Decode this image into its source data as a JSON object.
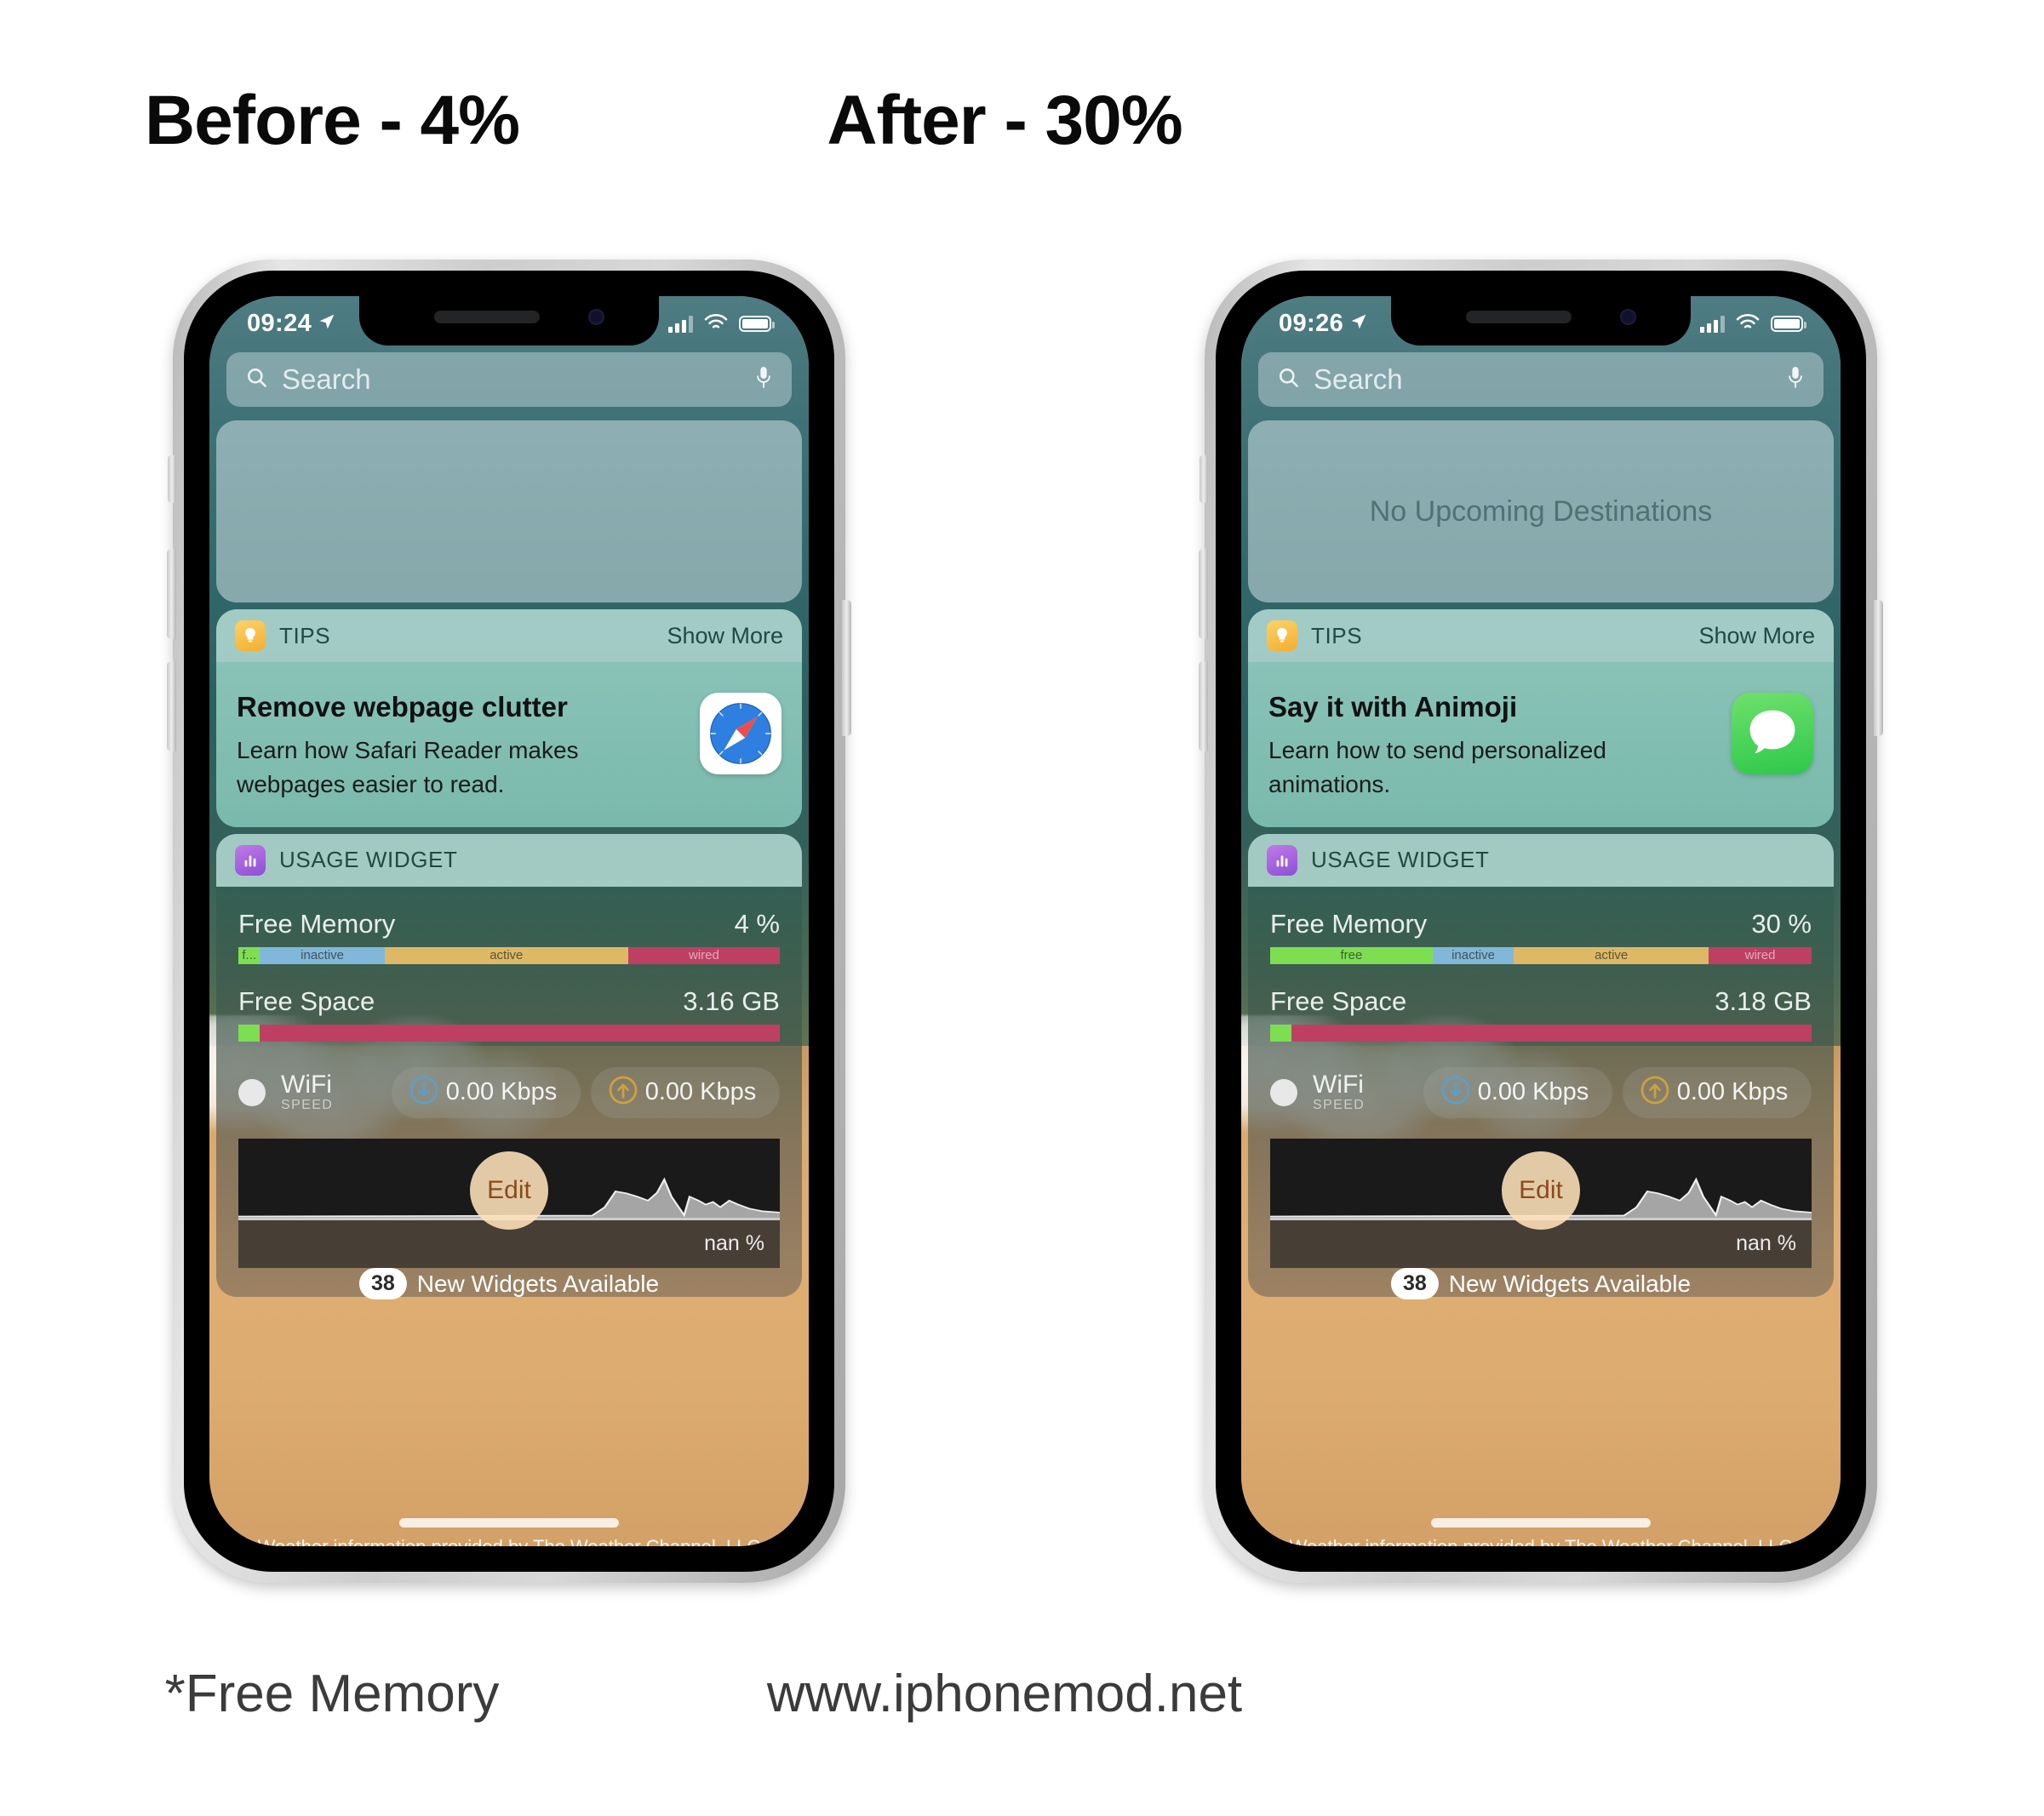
{
  "headings": {
    "left": "Before - 4%",
    "right": "After - 30%"
  },
  "captions": {
    "left": "*Free Memory",
    "right": "www.iphonemod.net"
  },
  "phones": [
    {
      "id": "before",
      "status_bar": {
        "time": "09:24",
        "location_icon": "location-arrow-icon",
        "cellular_icon": "signal-bars-icon",
        "wifi_icon": "wifi-icon",
        "battery_icon": "battery-icon"
      },
      "search": {
        "placeholder": "Search",
        "search_icon": "search-icon",
        "mic_icon": "microphone-icon"
      },
      "maps_widget": {
        "text": ""
      },
      "tips_widget": {
        "header": "TIPS",
        "action": "Show More",
        "icon": "tips-lightbulb-icon",
        "title": "Remove webpage clutter",
        "subtitle": "Learn how Safari Reader makes webpages easier to read.",
        "app_icon": "safari-compass-icon"
      },
      "usage_widget": {
        "header": "USAGE WIDGET",
        "icon": "usage-barchart-icon",
        "memory_label": "Free Memory",
        "memory_value": "4 %",
        "memory_segments": [
          {
            "label": "f...",
            "percent": 4,
            "key": "free"
          },
          {
            "label": "inactive",
            "percent": 23,
            "key": "inactive"
          },
          {
            "label": "active",
            "percent": 45,
            "key": "active"
          },
          {
            "label": "wired",
            "percent": 28,
            "key": "wired"
          }
        ],
        "space_label": "Free Space",
        "space_value": "3.16 GB",
        "space_free_percent": 4,
        "network_name": "WiFi",
        "network_sub": "SPEED",
        "download_icon": "download-arrow-icon",
        "download_value": "0.00 Kbps",
        "upload_icon": "upload-arrow-icon",
        "upload_value": "0.00 Kbps",
        "graph_footer": "nan %"
      },
      "edit_label": "Edit",
      "new_widgets_count": "38",
      "new_widgets_label": "New Widgets Available",
      "weather_credit": "Weather information provided by The Weather Channel, LLC"
    },
    {
      "id": "after",
      "status_bar": {
        "time": "09:26",
        "location_icon": "location-arrow-icon",
        "cellular_icon": "signal-bars-icon",
        "wifi_icon": "wifi-icon",
        "battery_icon": "battery-icon"
      },
      "search": {
        "placeholder": "Search",
        "search_icon": "search-icon",
        "mic_icon": "microphone-icon"
      },
      "maps_widget": {
        "text": "No Upcoming Destinations"
      },
      "tips_widget": {
        "header": "TIPS",
        "action": "Show More",
        "icon": "tips-lightbulb-icon",
        "title": "Say it with Animoji",
        "subtitle": "Learn how to send personalized animations.",
        "app_icon": "messages-bubble-icon"
      },
      "usage_widget": {
        "header": "USAGE WIDGET",
        "icon": "usage-barchart-icon",
        "memory_label": "Free Memory",
        "memory_value": "30 %",
        "memory_segments": [
          {
            "label": "free",
            "percent": 30,
            "key": "free"
          },
          {
            "label": "inactive",
            "percent": 15,
            "key": "inactive"
          },
          {
            "label": "active",
            "percent": 36,
            "key": "active"
          },
          {
            "label": "wired",
            "percent": 19,
            "key": "wired"
          }
        ],
        "space_label": "Free Space",
        "space_value": "3.18 GB",
        "space_free_percent": 4,
        "network_name": "WiFi",
        "network_sub": "SPEED",
        "download_icon": "download-arrow-icon",
        "download_value": "0.00 Kbps",
        "upload_icon": "upload-arrow-icon",
        "upload_value": "0.00 Kbps",
        "graph_footer": "nan %"
      },
      "edit_label": "Edit",
      "new_widgets_count": "38",
      "new_widgets_label": "New Widgets Available",
      "weather_credit": "Weather information provided by The Weather Channel, LLC"
    }
  ],
  "colors": {
    "free": "#7ede52",
    "inactive": "#81b8da",
    "active": "#ddb965",
    "wired": "#bd4063",
    "tips_accent": "#f3ae32",
    "usage_accent": "#8d4fd6"
  }
}
